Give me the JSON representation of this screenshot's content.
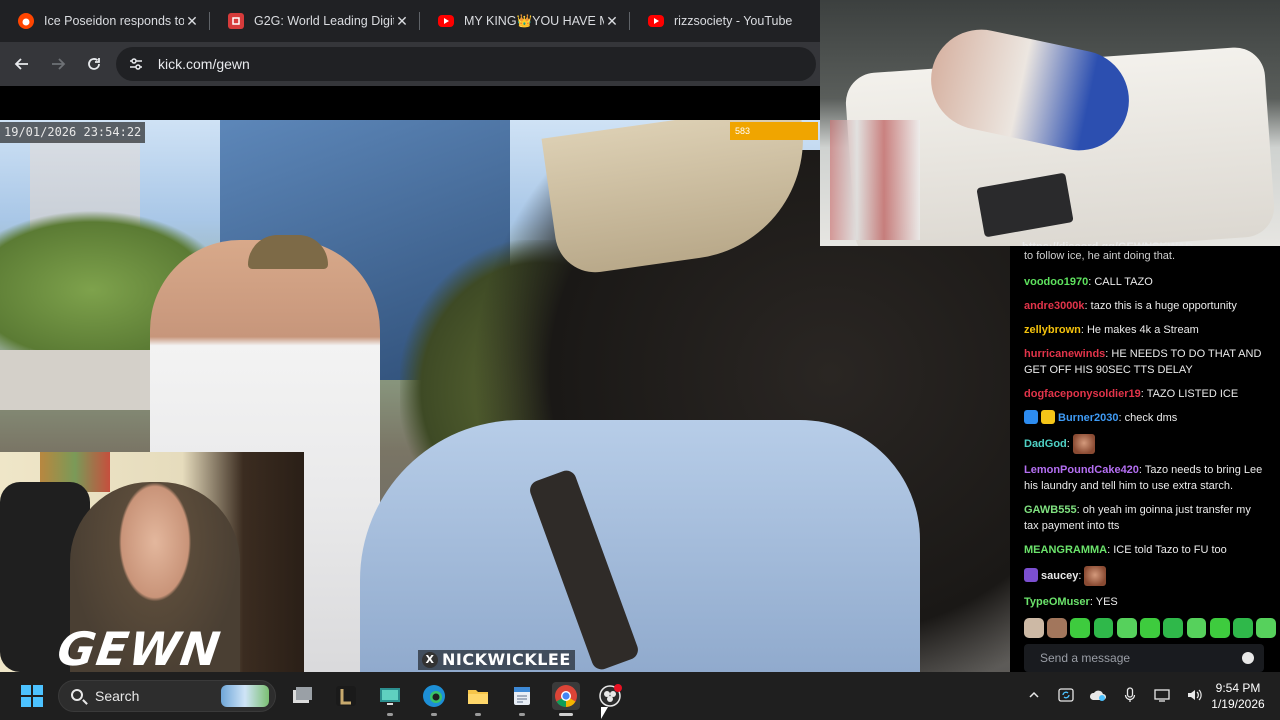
{
  "browser": {
    "tabs": [
      {
        "title": "Ice Poseidon responds to",
        "color": "#e0451f"
      },
      {
        "title": "G2G: World Leading Digit",
        "color": "#d63b3b"
      },
      {
        "title": "MY KING👑YOU HAVE M",
        "color": "#ff0000"
      },
      {
        "title": "rizzsociety - YouTube",
        "color": "#ff0000"
      }
    ],
    "close_glyph": "✕",
    "url": "kick.com/gewn"
  },
  "stream": {
    "timestamp": "19/01/2026 23:54:22",
    "goal_value": "583",
    "watermark_handle": "NICKWICKLEE",
    "watermark_x": "X",
    "overlay_title": "GEWN",
    "pip_discord_link": "https://discord.gg/GEWNSKWAD"
  },
  "chat": {
    "clipped_line": "to follow ice, he aint doing that.",
    "messages": [
      {
        "user": "voodoo1970",
        "color": "#5ee25e",
        "text": "CALL TAZO",
        "badges": []
      },
      {
        "user": "andre3000k",
        "color": "#e2344a",
        "text": "tazo this is a huge opportunity",
        "badges": []
      },
      {
        "user": "zellybrown",
        "color": "#f4c20d",
        "text": "He makes 4k a Stream",
        "badges": []
      },
      {
        "user": "hurricanewinds",
        "color": "#e2344a",
        "text": "HE NEEDS TO DO THAT AND GET OFF HIS 90SEC TTS DELAY",
        "badges": []
      },
      {
        "user": "dogfaceponysoldier19",
        "color": "#e2344a",
        "text": "TAZO LISTED ICE",
        "badges": []
      },
      {
        "user": "Burner2030",
        "color": "#3f9bf5",
        "text": "check dms",
        "badges": [
          "#2d8cf0",
          "#f5c518"
        ]
      },
      {
        "user": "DadGod",
        "color": "#4fd1c5",
        "text": "",
        "emote": true,
        "badges": []
      },
      {
        "user": "LemonPoundCake420",
        "color": "#b46ff2",
        "text": "Tazo needs to bring Lee his laundry and tell him to use extra starch.",
        "badges": []
      },
      {
        "user": "GAWB555",
        "color": "#7fe07f",
        "text": "oh yeah im goinna just transfer my tax payment into tts",
        "badges": []
      },
      {
        "user": "MEANGRAMMA",
        "color": "#6be36b",
        "text": "ICE told Tazo to FU too",
        "badges": []
      },
      {
        "user": "saucey",
        "color": "#e8e8e8",
        "text": "",
        "emote": true,
        "badges": [
          "#7b4fd0"
        ]
      },
      {
        "user": "TypeOMuser",
        "color": "#6be36b",
        "text": "YES",
        "badges": []
      }
    ],
    "send_placeholder": "Send a message"
  },
  "taskbar": {
    "search_label": "Search",
    "time": "9:54 PM",
    "date": "1/19/2026"
  }
}
